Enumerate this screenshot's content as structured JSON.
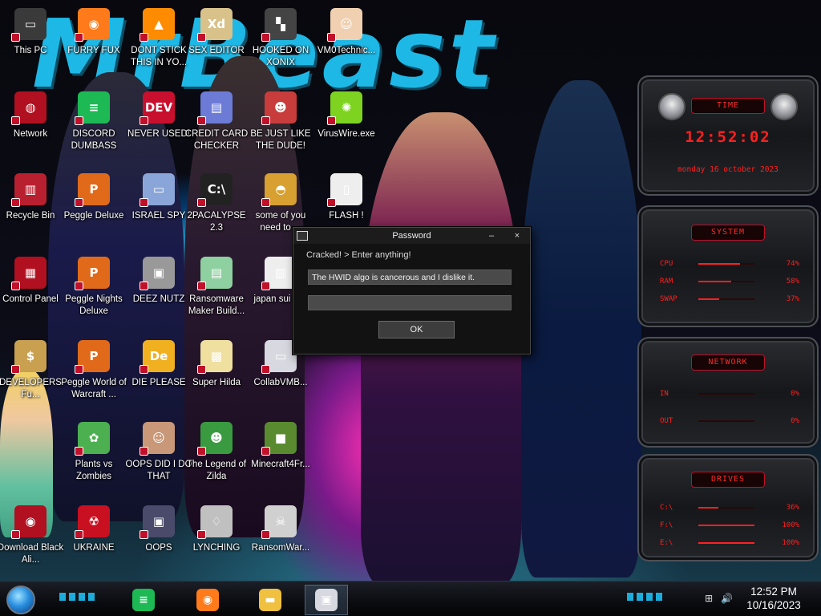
{
  "wallpaper": {
    "title_text": "MrBeast"
  },
  "desktop_icons": [
    {
      "label": "This PC",
      "glyph": "▭",
      "icon": "computer-icon",
      "color": "#3a3a3a"
    },
    {
      "label": "FURRY FUX",
      "glyph": "◉",
      "icon": "firefox-icon",
      "color": "#ff7a1a"
    },
    {
      "label": "DONT STICK THIS IN YO...",
      "glyph": "▲",
      "icon": "vlc-cone-icon",
      "color": "#ff8c00"
    },
    {
      "label": "SEX EDITOR",
      "glyph": "Xd",
      "icon": "xd-app-icon",
      "color": "#d8c28a"
    },
    {
      "label": "HOOKED ON XONIX",
      "glyph": "▚",
      "icon": "xonix-game-icon",
      "color": "#444"
    },
    {
      "label": "VM0Technic...",
      "glyph": "☺",
      "icon": "doctor-icon",
      "color": "#f0d0b0"
    },
    {
      "label": "Network",
      "glyph": "◍",
      "icon": "network-icon",
      "color": "#b01020"
    },
    {
      "label": "DISCORD DUMBASS",
      "glyph": "≡",
      "icon": "spotify-style-icon",
      "color": "#1db954"
    },
    {
      "label": "NEVER USED!",
      "glyph": "DEV",
      "icon": "dev-app-icon",
      "color": "#c8102e"
    },
    {
      "label": "CREDIT CARD CHECKER",
      "glyph": "▤",
      "icon": "credit-card-icon",
      "color": "#6b7bd6"
    },
    {
      "label": "BE JUST LIKE THE DUDE!",
      "glyph": "☻",
      "icon": "santa-icon",
      "color": "#c83c3c"
    },
    {
      "label": "VirusWire.exe",
      "glyph": "✺",
      "icon": "lime-icon",
      "color": "#7ed321"
    },
    {
      "label": "Recycle Bin",
      "glyph": "▥",
      "icon": "recycle-bin-icon",
      "color": "#b82030"
    },
    {
      "label": "Peggle Deluxe",
      "glyph": "P",
      "icon": "peggle-icon",
      "color": "#e06a1a"
    },
    {
      "label": "ISRAEL SPY",
      "glyph": "▭",
      "icon": "spy-app-icon",
      "color": "#8aa6d8"
    },
    {
      "label": "2PACALYPSE 2.3",
      "glyph": "C:\\",
      "icon": "terminal-icon",
      "color": "#222"
    },
    {
      "label": "some of you need to ...",
      "glyph": "◓",
      "icon": "beaver-icon",
      "color": "#d8a030"
    },
    {
      "label": "FLASH !",
      "glyph": "▯",
      "icon": "flash-file-icon",
      "color": "#eee"
    },
    {
      "label": "Control Panel",
      "glyph": "▦",
      "icon": "control-panel-icon",
      "color": "#b01020"
    },
    {
      "label": "Peggle Nights Deluxe",
      "glyph": "P",
      "icon": "peggle-nights-icon",
      "color": "#e06a1a"
    },
    {
      "label": "DEEZ NUTZ",
      "glyph": "▣",
      "icon": "windows-stack-icon",
      "color": "#999"
    },
    {
      "label": "Ransomware Maker Build...",
      "glyph": "▤",
      "icon": "installer-icon",
      "color": "#8fd0a0"
    },
    {
      "label": "japan sui sim",
      "glyph": "▥",
      "icon": "document-icon",
      "color": "#eee"
    },
    {
      "label": "DEVELOPERS Fu...",
      "glyph": "$",
      "icon": "money-bag-icon",
      "color": "#c8a050"
    },
    {
      "label": "Peggle World of Warcraft ...",
      "glyph": "P",
      "icon": "peggle-wow-icon",
      "color": "#e06a1a"
    },
    {
      "label": "DIE PLEASE",
      "glyph": "De",
      "icon": "de-app-icon",
      "color": "#f0b020"
    },
    {
      "label": "Super Hilda",
      "glyph": "▩",
      "icon": "pixel-game-icon",
      "color": "#f0e0a0"
    },
    {
      "label": "CollabVMB...",
      "glyph": "▭",
      "icon": "collabvm-icon",
      "color": "#d8d8e0"
    },
    {
      "label": "Plants vs Zombies",
      "glyph": "✿",
      "icon": "plant-icon",
      "color": "#4caf50"
    },
    {
      "label": "OOPS DID I DO THAT",
      "glyph": "☺",
      "icon": "portrait-icon",
      "color": "#c89878"
    },
    {
      "label": "The Legend of Zilda",
      "glyph": "☻",
      "icon": "zelda-icon",
      "color": "#3a9a40"
    },
    {
      "label": "Minecraft4Fr...",
      "glyph": "■",
      "icon": "minecraft-icon",
      "color": "#5a8a30"
    },
    {
      "label": "Download Black Ali...",
      "glyph": "◉",
      "icon": "alien-icon",
      "color": "#b01020"
    },
    {
      "label": "UKRAINE",
      "glyph": "☢",
      "icon": "radiation-icon",
      "color": "#c81020"
    },
    {
      "label": "OOPS",
      "glyph": "▣",
      "icon": "computer-error-icon",
      "color": "#4a4a6a"
    },
    {
      "label": "LYNCHING",
      "glyph": "♢",
      "icon": "lynching-icon",
      "color": "#c0c0c0"
    },
    {
      "label": "RansomWar...",
      "glyph": "☠",
      "icon": "skull-icon",
      "color": "#d0d0d0"
    }
  ],
  "dialog": {
    "title": "Password",
    "minimize_label": "–",
    "close_label": "×",
    "prompt": "Cracked! > Enter anything!",
    "field1_value": "The HWID algo is cancerous and I dislike it.",
    "field2_value": "",
    "ok_label": "OK"
  },
  "gadgets": {
    "time": {
      "header": "TIME",
      "clock": "12:52:02",
      "date": "monday 16 october 2023"
    },
    "system": {
      "header": "SYSTEM",
      "rows": [
        {
          "key": "CPU",
          "value": "74%",
          "level": 0.74
        },
        {
          "key": "RAM",
          "value": "58%",
          "level": 0.58
        },
        {
          "key": "SWAP",
          "value": "37%",
          "level": 0.37
        }
      ]
    },
    "network": {
      "header": "NETWORK",
      "rows": [
        {
          "key": "IN",
          "value": "0%",
          "level": 0.0
        },
        {
          "key": "OUT",
          "value": "0%",
          "level": 0.0
        }
      ]
    },
    "drives": {
      "header": "DRIVES",
      "rows": [
        {
          "key": "C:\\",
          "value": "36%",
          "level": 0.36
        },
        {
          "key": "F:\\",
          "value": "100%",
          "level": 1.0
        },
        {
          "key": "E:\\",
          "value": "100%",
          "level": 1.0
        }
      ]
    }
  },
  "taskbar": {
    "apps": [
      {
        "name": "spotify-style",
        "glyph": "≡",
        "color": "#1db954",
        "active": false
      },
      {
        "name": "firefox",
        "glyph": "◉",
        "color": "#ff7a1a",
        "active": false
      },
      {
        "name": "file-explorer",
        "glyph": "▬",
        "color": "#f0c040",
        "active": false
      },
      {
        "name": "password-app",
        "glyph": "▣",
        "color": "#d8d8e0",
        "active": true
      }
    ],
    "tray": {
      "network": "⊞",
      "volume": "🔊"
    },
    "clock": {
      "time": "12:52 PM",
      "date": "10/16/2023"
    }
  }
}
